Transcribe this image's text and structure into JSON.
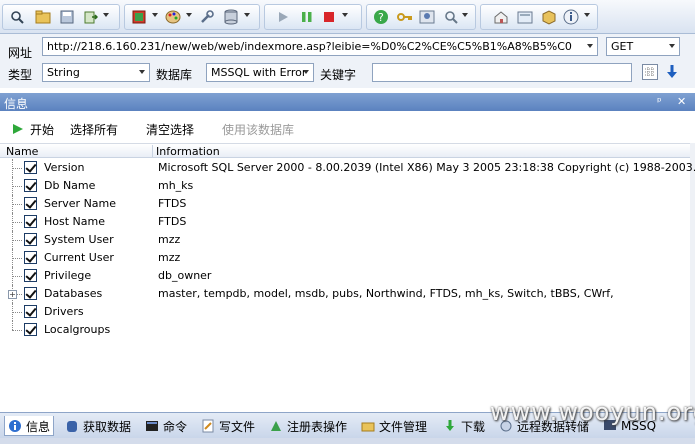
{
  "toolbar": {
    "icons": [
      "search-icon",
      "folder-icon",
      "save-icon",
      "export-icon",
      "settings-icon",
      "palette-icon",
      "wrench-icon",
      "database-icon",
      "play-icon",
      "pause-icon",
      "stop-icon",
      "help-icon",
      "key-icon",
      "users-icon",
      "search-icon",
      "home-icon",
      "open-icon",
      "package-icon",
      "info-icon"
    ]
  },
  "form": {
    "url_label": "网址",
    "url_value": "http://218.6.160.231/new/web/web/indexmore.asp?leibie=%D0%C2%CE%C5%B1%A8%B5%C0",
    "method_value": "GET",
    "type_label": "类型",
    "type_value": "String",
    "db_label": "数据库",
    "db_value": "MSSQL with Error",
    "keyword_label": "关键字",
    "keyword_value": ""
  },
  "panel": {
    "title": "信息",
    "pin": "ᵖ",
    "close": "✕"
  },
  "actions": {
    "start": "开始",
    "select_all": "选择所有",
    "clear_selection": "清空选择",
    "use_database": "使用该数据库"
  },
  "table": {
    "col_name": "Name",
    "col_info": "Information",
    "rows": [
      {
        "name": "Version",
        "info": "Microsoft SQL Server  2000 - 8.00.2039 (Intel X86) May  3 2005 23:18:38 Copyright (c) 1988-2003..."
      },
      {
        "name": "Db Name",
        "info": "mh_ks"
      },
      {
        "name": "Server Name",
        "info": "FTDS"
      },
      {
        "name": "Host Name",
        "info": "FTDS"
      },
      {
        "name": "System User",
        "info": "mzz"
      },
      {
        "name": "Current User",
        "info": "mzz"
      },
      {
        "name": "Privilege",
        "info": "db_owner"
      },
      {
        "name": "Databases",
        "info": "master, tempdb, model, msdb, pubs, Northwind, FTDS, mh_ks, Switch, tBBS, CWrf,"
      },
      {
        "name": "Drivers",
        "info": ""
      },
      {
        "name": "Localgroups",
        "info": ""
      }
    ]
  },
  "tabs": [
    "信息",
    "获取数据",
    "命令",
    "写文件",
    "注册表操作",
    "文件管理",
    "下载",
    "远程数据转储",
    "MSSQ"
  ],
  "watermark": "www.wooyun.org",
  "colors": {
    "accent": "#5b82bf",
    "check": "#1c3c66"
  }
}
